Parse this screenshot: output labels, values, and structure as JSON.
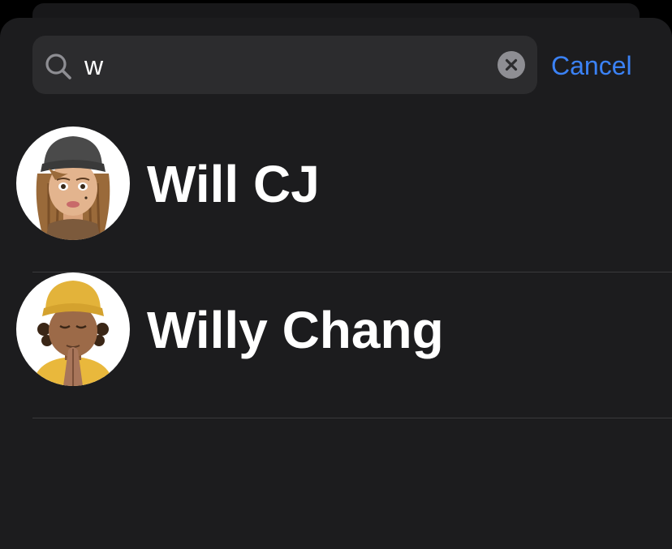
{
  "search": {
    "query": "w",
    "cancel_label": "Cancel"
  },
  "results": [
    {
      "name": "Will CJ",
      "avatar": "memoji-beanie-long-hair"
    },
    {
      "name": "Willy Chang",
      "avatar": "memoji-yellow-beanie-praying"
    }
  ],
  "colors": {
    "background": "#1c1c1e",
    "search_field": "#2c2c2e",
    "accent": "#3b82f6",
    "separator": "#3a3a3c"
  }
}
